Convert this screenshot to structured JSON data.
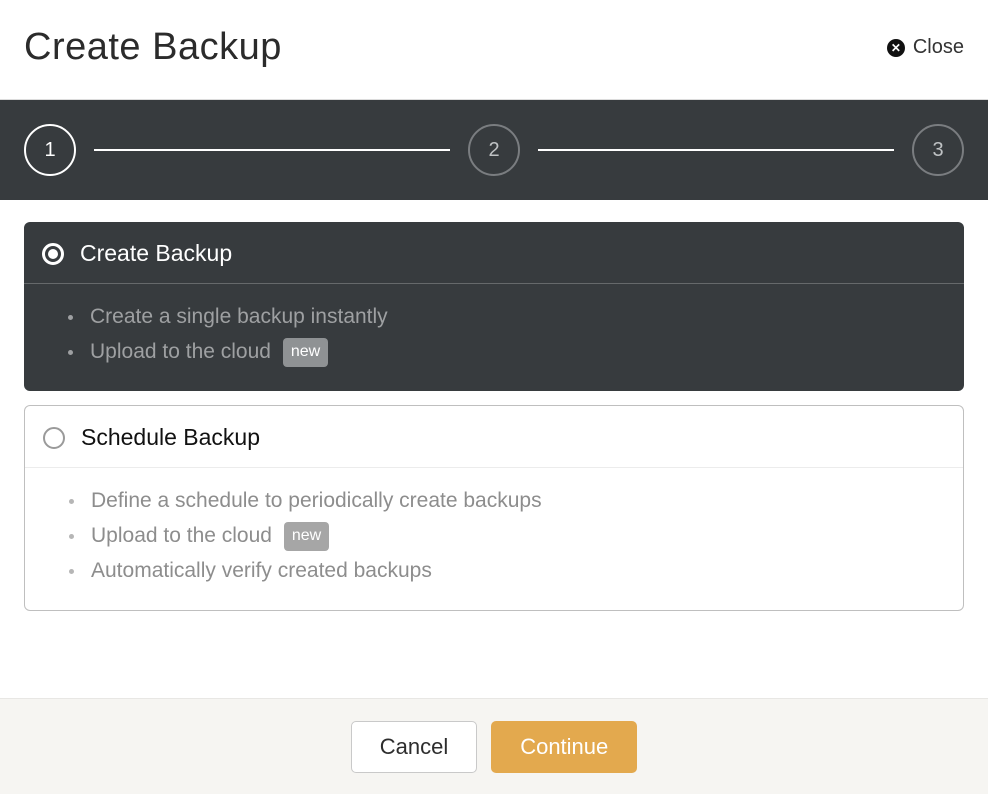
{
  "header": {
    "title": "Create Backup",
    "close_label": "Close"
  },
  "stepper": {
    "steps": [
      "1",
      "2",
      "3"
    ],
    "active_index": 0
  },
  "options": [
    {
      "id": "create-backup",
      "title": "Create Backup",
      "selected": true,
      "features": [
        {
          "text": "Create a single backup instantly",
          "badge": null
        },
        {
          "text": "Upload to the cloud",
          "badge": "new"
        }
      ]
    },
    {
      "id": "schedule-backup",
      "title": "Schedule Backup",
      "selected": false,
      "features": [
        {
          "text": "Define a schedule to periodically create backups",
          "badge": null
        },
        {
          "text": "Upload to the cloud",
          "badge": "new"
        },
        {
          "text": "Automatically verify created backups",
          "badge": null
        }
      ]
    }
  ],
  "footer": {
    "cancel_label": "Cancel",
    "continue_label": "Continue"
  }
}
